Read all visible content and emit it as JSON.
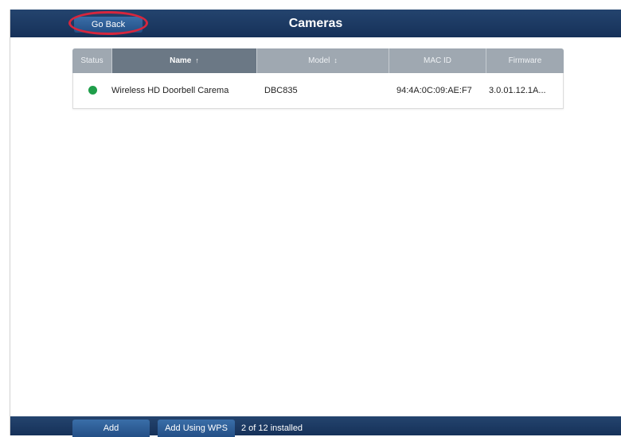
{
  "header": {
    "title": "Cameras",
    "back_label": "Go Back"
  },
  "table": {
    "columns": [
      {
        "label": "Status",
        "sorted": false,
        "sort_icon": ""
      },
      {
        "label": "Name",
        "sorted": true,
        "sort_icon": "↑"
      },
      {
        "label": "Model",
        "sorted": false,
        "sort_icon": "↕"
      },
      {
        "label": "MAC ID",
        "sorted": false,
        "sort_icon": ""
      },
      {
        "label": "Firmware",
        "sorted": false,
        "sort_icon": ""
      }
    ],
    "rows": [
      {
        "status": "online",
        "status_color": "#1f9e4a",
        "name": "Wireless HD Doorbell Carema",
        "model": "DBC835",
        "mac": "94:4A:0C:09:AE:F7",
        "firmware": "3.0.01.12.1A..."
      }
    ]
  },
  "footer": {
    "add_label": "Add",
    "add_wps_label": "Add Using WPS",
    "installed_text": "2 of 12 installed"
  },
  "colors": {
    "bar": "#1b3a63",
    "highlight_ring": "#d7263d",
    "status_online": "#1f9e4a"
  }
}
